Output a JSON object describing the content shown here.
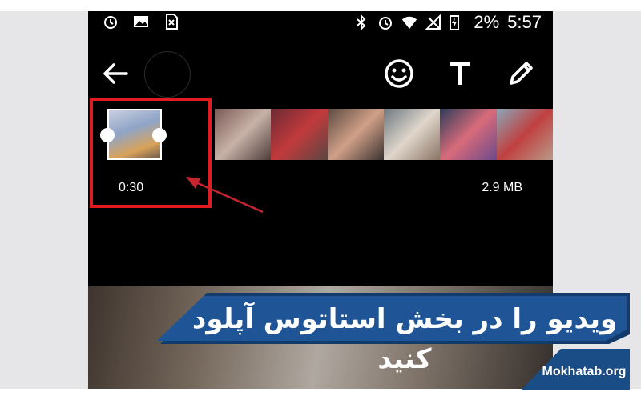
{
  "status_bar": {
    "battery": "2%",
    "time": "5:57",
    "left_icons": [
      "alarm-icon",
      "image-icon",
      "sim-off-icon"
    ],
    "right_icons": [
      "bluetooth-icon",
      "alarm-icon",
      "wifi-icon",
      "no-signal-icon",
      "battery-charging-icon"
    ]
  },
  "toolbar": {
    "icons": [
      "back-arrow-icon",
      "emoji-icon",
      "text-icon",
      "pencil-icon"
    ]
  },
  "video_editor": {
    "duration": "0:30",
    "file_size": "2.9 MB",
    "filmstrip_frames": 6
  },
  "banner": {
    "caption": "ویدیو را در بخش استاتوس آپلود کنید",
    "watermark": "Mokhatab.org"
  },
  "colors": {
    "highlight_red": "#e21b23",
    "banner_blue": "#1f5596",
    "banner_dark": "#123b6b"
  }
}
